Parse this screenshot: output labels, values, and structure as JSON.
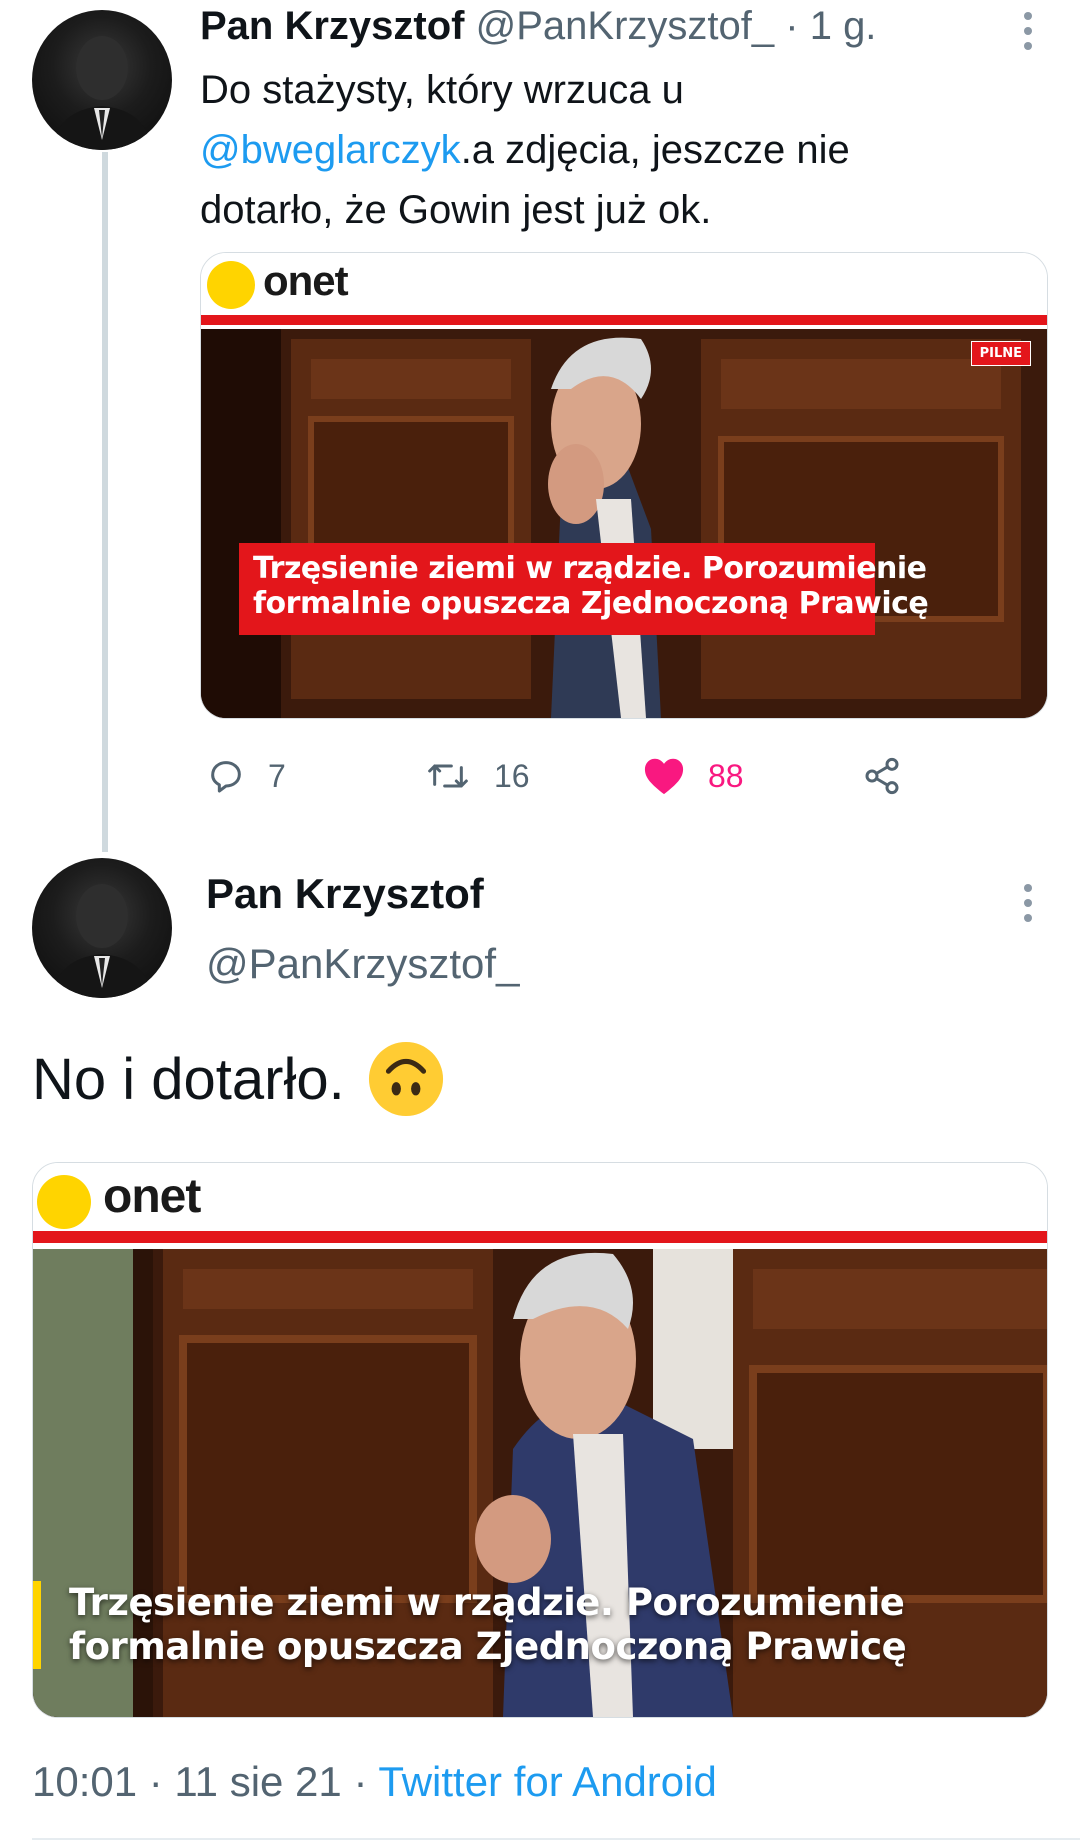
{
  "first_tweet": {
    "display_name": "Pan Krzysztof",
    "handle": "@PanKrzysztof_",
    "separator": "·",
    "time_ago": "1 g.",
    "text_part1": "Do stażysty, który wrzuca u",
    "mention": "@bweglarczyk",
    "text_part2": ".a zdjęcia, jeszcze nie",
    "text_line3": "dotarło, że Gowin jest już ok.",
    "card": {
      "logo_text": "onet",
      "badge": "PILNE",
      "headline_line1": "Trzęsienie ziemi w rządzie. Porozumienie",
      "headline_line2": "formalnie opuszcza Zjednoczoną Prawicę"
    },
    "actions": {
      "replies": "7",
      "retweets": "16",
      "likes": "88"
    }
  },
  "main_tweet": {
    "display_name": "Pan Krzysztof",
    "handle": "@PanKrzysztof_",
    "text": "No i dotarło.",
    "emoji": "upside-down-face-emoji",
    "card": {
      "logo_text": "onet",
      "headline_line1": "Trzęsienie ziemi w rządzie. Porozumienie",
      "headline_line2": "formalnie opuszcza Zjednoczoną Prawicę"
    },
    "timestamp": "10:01 · 11 sie 21 ·",
    "source": "Twitter for Android"
  },
  "colors": {
    "link": "#1d9bf0",
    "like": "#f91880",
    "onet_yellow": "#ffd400",
    "onet_red": "#e3161b",
    "muted_text": "#536471"
  }
}
